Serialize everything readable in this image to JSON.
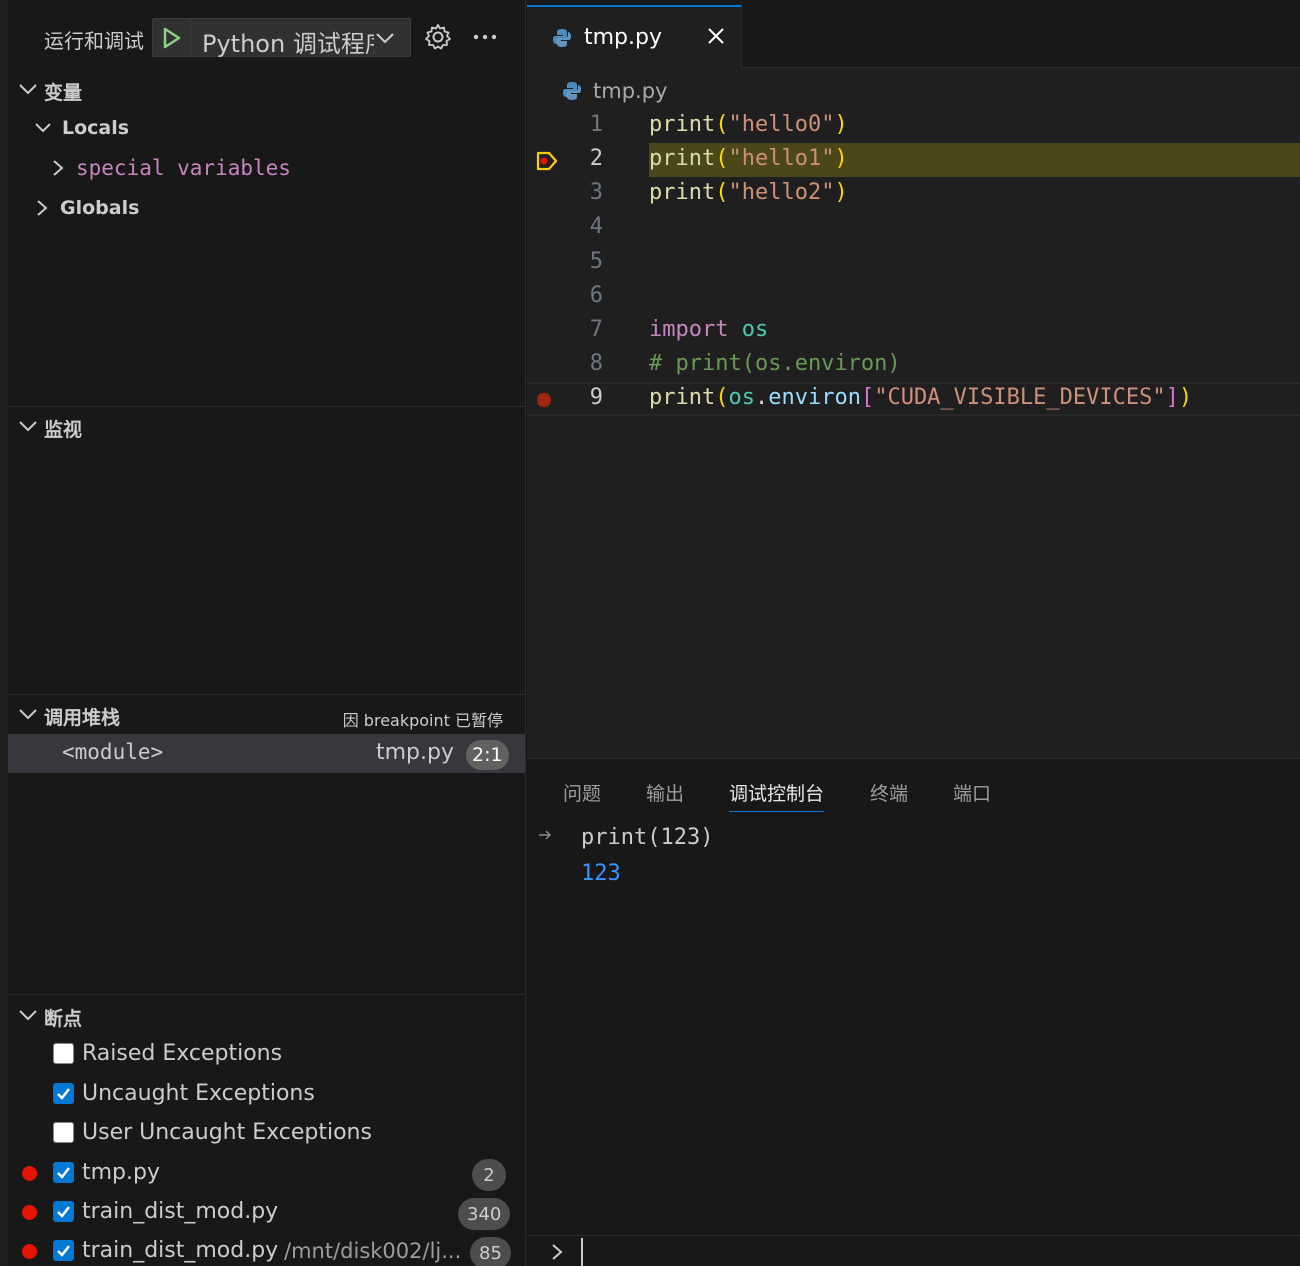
{
  "sidebar": {
    "run_title": "运行和调试",
    "config_label": "Python 调试程序",
    "variables": {
      "title": "变量",
      "locals": "Locals",
      "special_variables": "special variables",
      "globals": "Globals"
    },
    "watch": {
      "title": "监视"
    },
    "call_stack": {
      "title": "调用堆栈",
      "paused_note": "因 breakpoint 已暂停",
      "frame_name": "<module>",
      "frame_file": "tmp.py",
      "frame_pos": "2:1"
    },
    "breakpoints": {
      "title": "断点",
      "items": [
        {
          "label": "Raised Exceptions",
          "checked": false
        },
        {
          "label": "Uncaught Exceptions",
          "checked": true
        },
        {
          "label": "User Uncaught Exceptions",
          "checked": false
        },
        {
          "label": "tmp.py",
          "checked": true,
          "count": "2"
        },
        {
          "label": "train_dist_mod.py",
          "checked": true,
          "count": "340"
        },
        {
          "label": "train_dist_mod.py",
          "checked": true,
          "path": "/mnt/disk002/lj...",
          "count": "85"
        }
      ]
    }
  },
  "editor": {
    "tab_label": "tmp.py",
    "breadcrumb": "tmp.py",
    "line_numbers": [
      "1",
      "2",
      "3",
      "4",
      "5",
      "6",
      "7",
      "8",
      "9"
    ],
    "lines": {
      "l1": {
        "fn": "print",
        "open": "(",
        "str": "\"hello0\"",
        "close": ")"
      },
      "l2": {
        "fn": "print",
        "open": "(",
        "str": "\"hello1\"",
        "close": ")"
      },
      "l3": {
        "fn": "print",
        "open": "(",
        "str": "\"hello2\"",
        "close": ")"
      },
      "l7": {
        "kw": "import",
        "mod": "os"
      },
      "l8": {
        "comment": "# print(os.environ)"
      },
      "l9": {
        "fn": "print",
        "open": "(",
        "mod": "os",
        "dot": ".",
        "prop": "environ",
        "bopen": "[",
        "str": "\"CUDA_VISIBLE_DEVICES\"",
        "bclose": "]",
        "close": ")"
      }
    }
  },
  "panel": {
    "tabs": [
      "问题",
      "输出",
      "调试控制台",
      "终端",
      "端口"
    ],
    "console_input": "print(123)",
    "console_output": "123"
  },
  "colors": {
    "accent": "#0078d4",
    "breakpoint": "#e51400",
    "current_line": "#4b4718"
  }
}
